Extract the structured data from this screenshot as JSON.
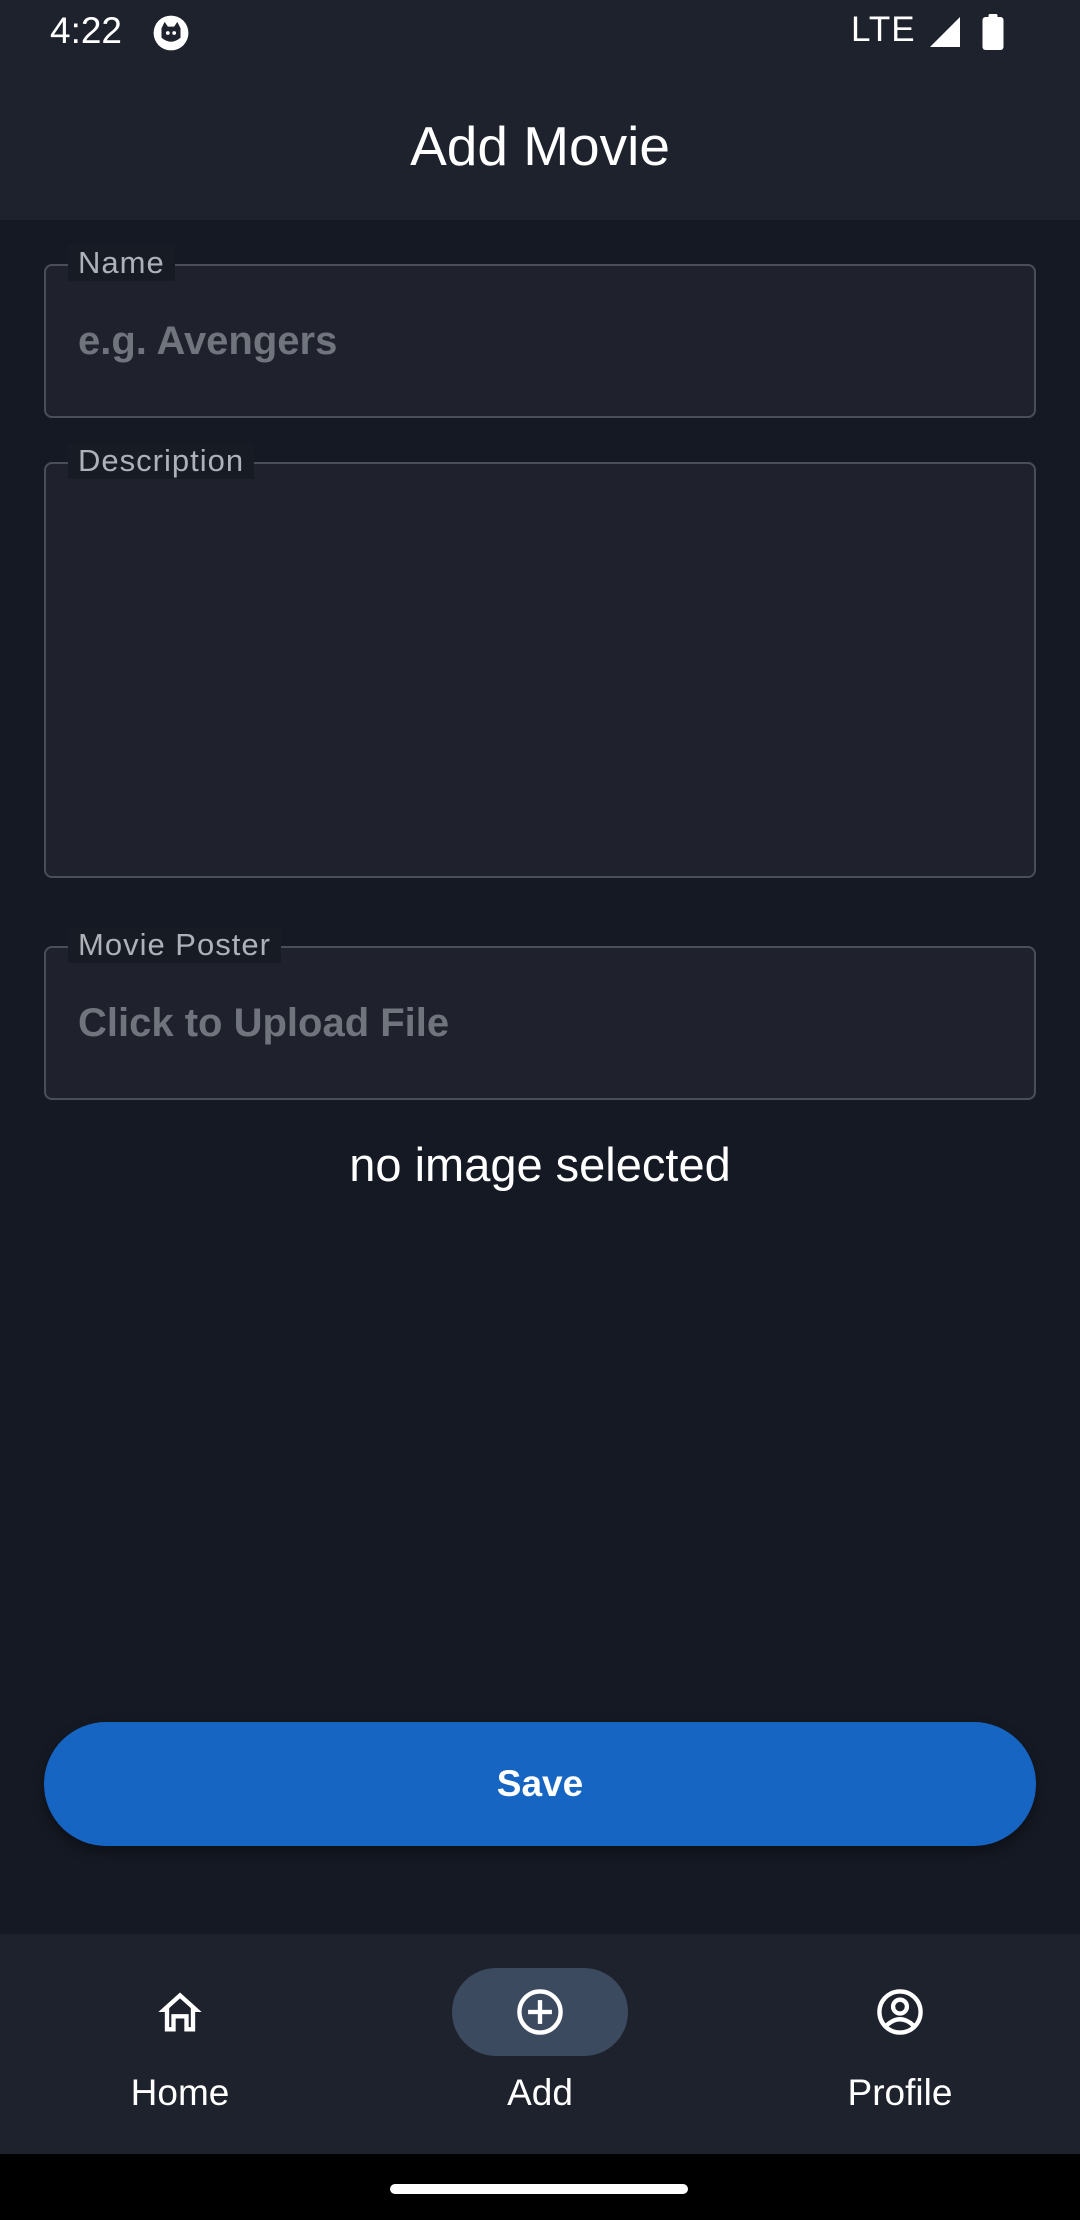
{
  "status_bar": {
    "time": "4:22",
    "network": "LTE",
    "icons": [
      "cat-icon",
      "signal-icon",
      "battery-icon"
    ]
  },
  "app_bar": {
    "title": "Add Movie"
  },
  "form": {
    "name": {
      "label": "Name",
      "placeholder": "e.g. Avengers",
      "value": ""
    },
    "description": {
      "label": "Description",
      "value": ""
    },
    "poster": {
      "label": "Movie Poster",
      "placeholder": "Click to Upload File",
      "value": ""
    },
    "image_status": "no image selected",
    "save_label": "Save"
  },
  "bottom_nav": {
    "items": [
      {
        "label": "Home",
        "icon": "home-icon",
        "active": false
      },
      {
        "label": "Add",
        "icon": "add-circle-icon",
        "active": true
      },
      {
        "label": "Profile",
        "icon": "profile-icon",
        "active": false
      }
    ]
  },
  "colors": {
    "background": "#151923",
    "surface": "#1e222c",
    "accent": "#1765c2",
    "nav_active": "#3b4a5e"
  }
}
